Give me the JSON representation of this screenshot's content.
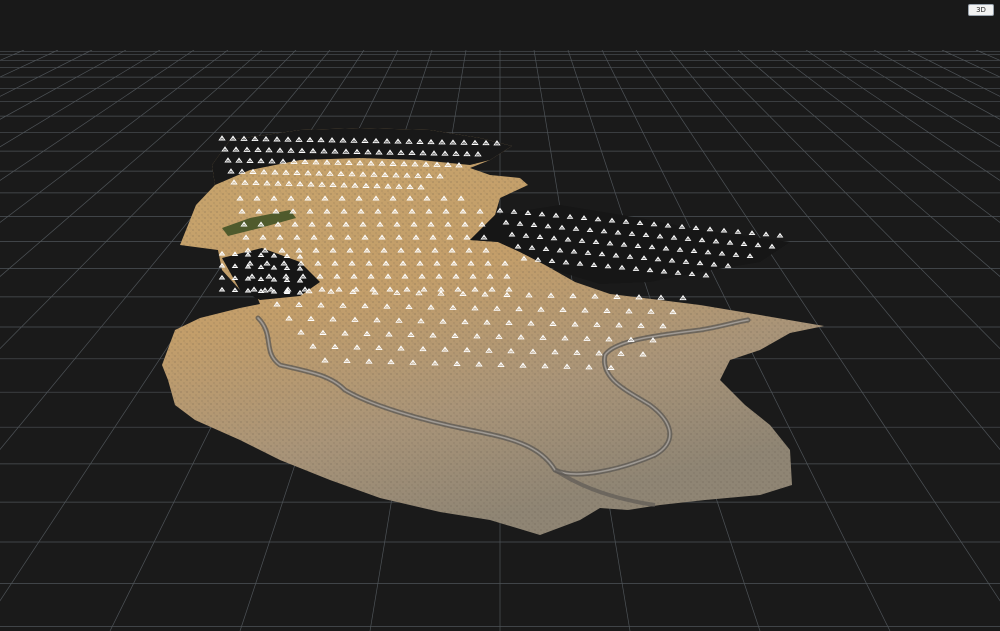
{
  "viewer": {
    "mode_label": "3D",
    "colors": {
      "background": "#161616",
      "grid": "#5f666c",
      "camera_marker": "#ffffff",
      "terrain": "#b9a07a"
    },
    "camera_marker_icon": "triangle-outline"
  }
}
